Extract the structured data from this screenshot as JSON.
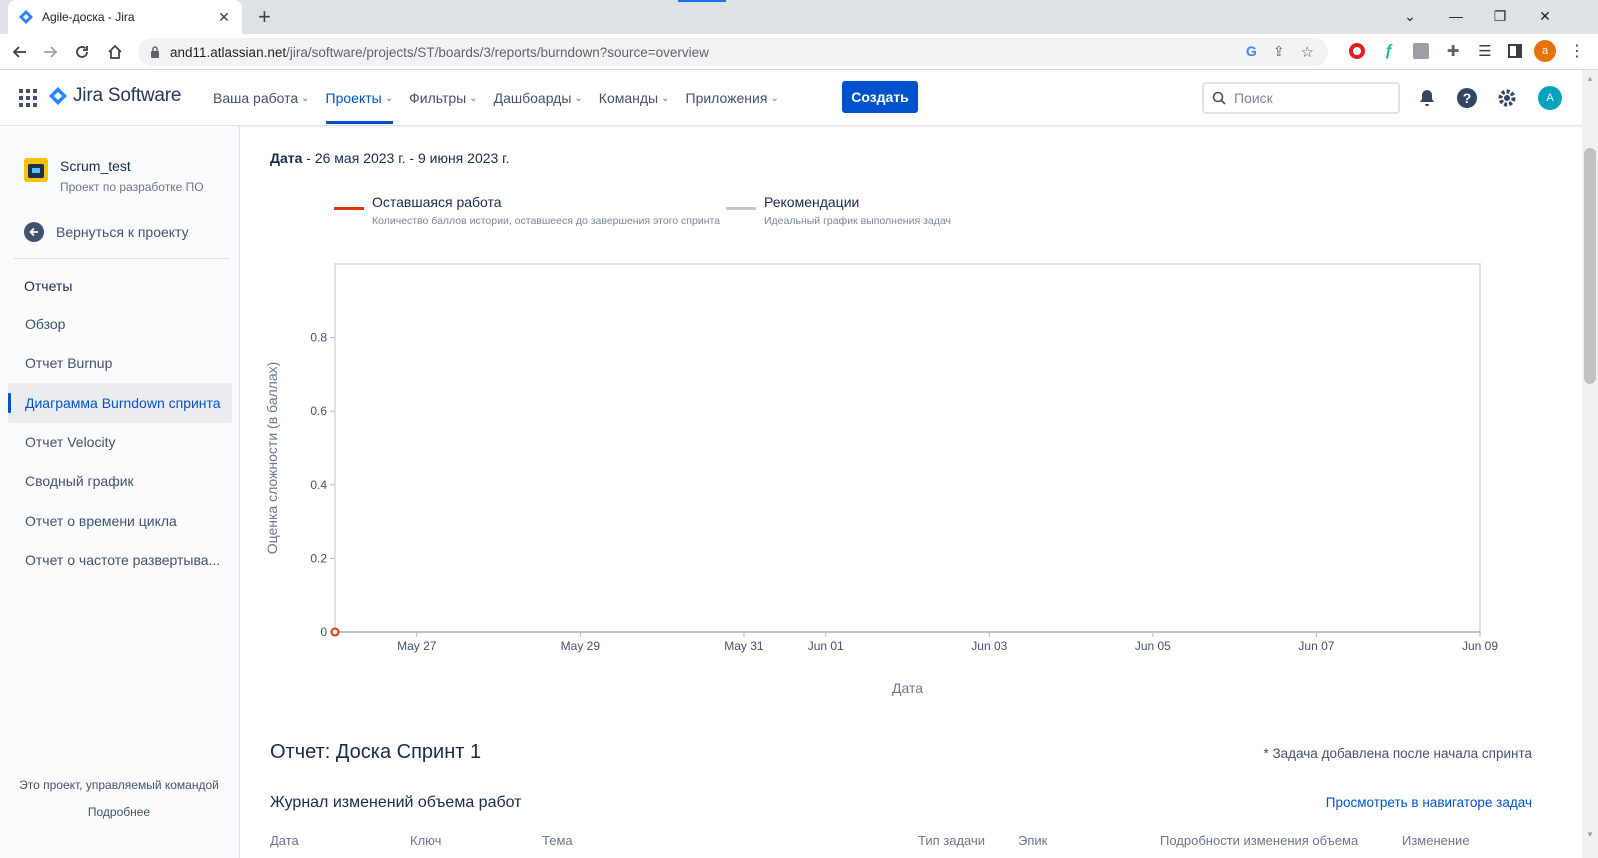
{
  "browser": {
    "tab_title": "Agile-доска - Jira",
    "url_host": "and11.atlassian.net",
    "url_path": "/jira/software/projects/ST/boards/3/reports/burndown?source=overview",
    "profile_initial": "a"
  },
  "header": {
    "product": "Jira Software",
    "nav": [
      {
        "label": "Ваша работа",
        "active": false
      },
      {
        "label": "Проекты",
        "active": true
      },
      {
        "label": "Фильтры",
        "active": false
      },
      {
        "label": "Дашбоарды",
        "active": false
      },
      {
        "label": "Команды",
        "active": false
      },
      {
        "label": "Приложения",
        "active": false
      }
    ],
    "create_label": "Создать",
    "search_placeholder": "Поиск",
    "avatar_initial": "A"
  },
  "sidebar": {
    "project_name": "Scrum_test",
    "project_type": "Проект по разработке ПО",
    "back_label": "Вернуться к проекту",
    "section_title": "Отчеты",
    "items": [
      {
        "label": "Обзор",
        "active": false
      },
      {
        "label": "Отчет Burnup",
        "active": false
      },
      {
        "label": "Диаграмма Burndown спринта",
        "active": true
      },
      {
        "label": "Отчет Velocity",
        "active": false
      },
      {
        "label": "Сводный график",
        "active": false
      },
      {
        "label": "Отчет о времени цикла",
        "active": false
      },
      {
        "label": "Отчет о частоте развертыва...",
        "active": false
      }
    ],
    "footer_text": "Это проект, управляемый командой",
    "footer_link": "Подробнее"
  },
  "report": {
    "date_label": "Дата",
    "date_range": " - 26 мая 2023 г. - 9 июня 2023 г.",
    "legend": [
      {
        "name": "Оставшаяся работа",
        "desc": "Количество баллов истории, оставшееся до завершения этого спринта",
        "color": "#de350b"
      },
      {
        "name": "Рекомендации",
        "desc": "Идеальный график выполнения задач",
        "color": "#c1c7d0"
      }
    ],
    "title": "Отчет: Доска Спринт 1",
    "note": "* Задача добавлена после начала спринта",
    "log_title": "Журнал изменений объема работ",
    "log_link": "Просмотреть в навигаторе задач",
    "columns": [
      "Дата",
      "Ключ",
      "Тема",
      "Тип задачи",
      "Эпик",
      "Подробности изменения объема",
      "Изменение"
    ]
  },
  "chart_data": {
    "type": "line",
    "xlabel": "Дата",
    "ylabel": "Оценка сложности (в баллах)",
    "x_ticks": [
      "May 27",
      "May 29",
      "May 31",
      "Jun 01",
      "Jun 03",
      "Jun 05",
      "Jun 07",
      "Jun 09"
    ],
    "y_ticks": [
      "0",
      "0.2",
      "0.4",
      "0.6",
      "0.8"
    ],
    "ylim": [
      0,
      1
    ],
    "series": [
      {
        "name": "Оставшаяся работа",
        "color": "#de350b",
        "points": [
          {
            "x": "2023-05-26",
            "y": 0
          }
        ]
      },
      {
        "name": "Рекомендации",
        "color": "#c1c7d0",
        "points": []
      }
    ]
  }
}
